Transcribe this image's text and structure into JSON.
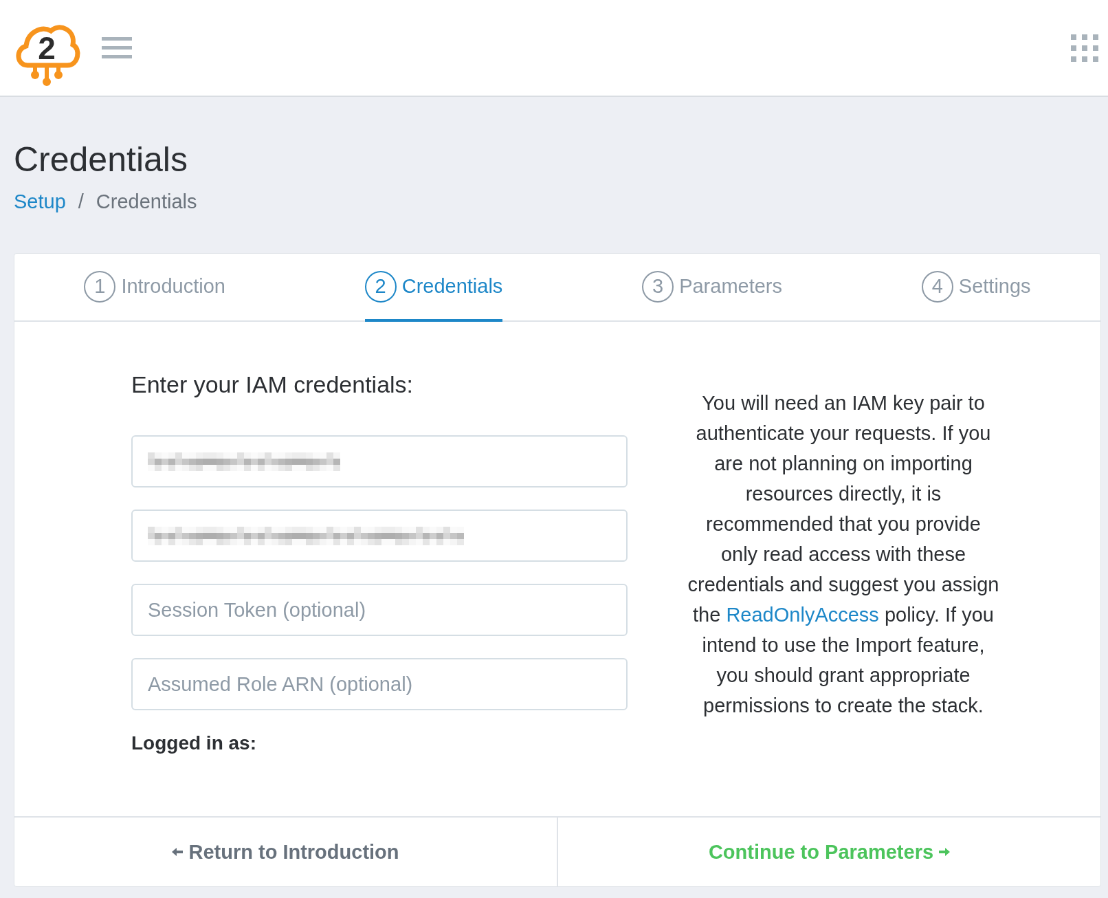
{
  "logo": {
    "text": "2"
  },
  "page": {
    "title": "Credentials",
    "separator": "/",
    "breadcrumb": [
      {
        "label": "Setup",
        "link": true
      },
      {
        "label": "Credentials",
        "link": false
      }
    ]
  },
  "tabs": [
    {
      "number": "1",
      "label": "Introduction",
      "selected": false
    },
    {
      "number": "2",
      "label": "Credentials",
      "selected": true
    },
    {
      "number": "3",
      "label": "Parameters",
      "selected": false
    },
    {
      "number": "4",
      "label": "Settings",
      "selected": false
    }
  ],
  "form": {
    "heading": "Enter your IAM credentials:",
    "fields": [
      {
        "kind": "redacted"
      },
      {
        "kind": "redacted"
      },
      {
        "kind": "empty",
        "placeholder": "Session Token (optional)"
      },
      {
        "kind": "empty",
        "placeholder": "Assumed Role ARN (optional)"
      }
    ],
    "logged_in_label": "Logged in as:"
  },
  "help": {
    "before": "You will need an IAM key pair to authenticate your requests. If you are not planning on importing resources directly, it is recommended that you provide only read access with these credentials and suggest you assign the",
    "link": "ReadOnlyAccess",
    "after": "policy. If you intend to use the Import feature, you should grant appropriate permissions to create the stack."
  },
  "footer": {
    "back": "Return to Introduction",
    "next": "Continue to Parameters"
  }
}
